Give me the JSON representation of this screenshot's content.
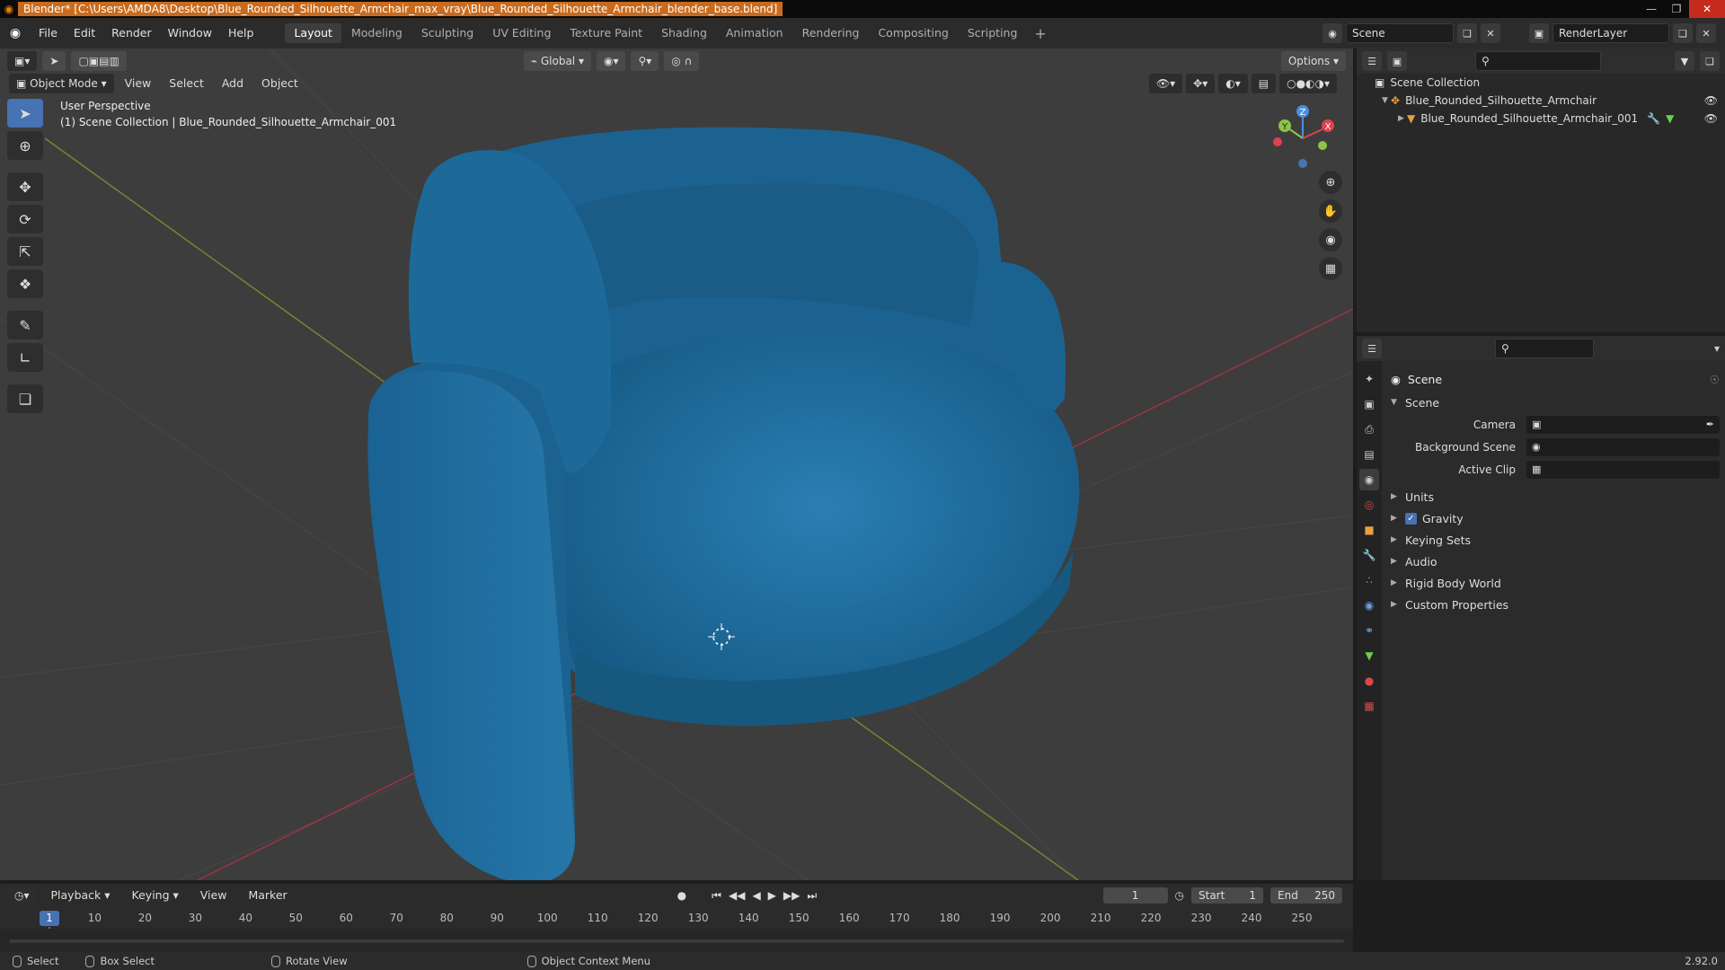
{
  "window": {
    "title": "Blender* [C:\\Users\\AMDA8\\Desktop\\Blue_Rounded_Silhouette_Armchair_max_vray\\Blue_Rounded_Silhouette_Armchair_blender_base.blend]"
  },
  "menu": [
    "File",
    "Edit",
    "Render",
    "Window",
    "Help"
  ],
  "workspaces": [
    "Layout",
    "Modeling",
    "Sculpting",
    "UV Editing",
    "Texture Paint",
    "Shading",
    "Animation",
    "Rendering",
    "Compositing",
    "Scripting"
  ],
  "active_workspace": "Layout",
  "scene_name": "Scene",
  "view_layer": "RenderLayer",
  "viewport": {
    "transform_orientation": "Global",
    "options_label": "Options",
    "mode": "Object Mode",
    "menus": [
      "View",
      "Select",
      "Add",
      "Object"
    ],
    "perspective": "User Perspective",
    "context": "(1) Scene Collection | Blue_Rounded_Silhouette_Armchair_001",
    "gizmo_axes": [
      "Z",
      "Y",
      "X"
    ]
  },
  "outliner": {
    "root": "Scene Collection",
    "items": [
      "Blue_Rounded_Silhouette_Armchair",
      "Blue_Rounded_Silhouette_Armchair_001"
    ]
  },
  "properties": {
    "title": "Scene",
    "panel": "Scene",
    "fields": [
      {
        "label": "Camera"
      },
      {
        "label": "Background Scene"
      },
      {
        "label": "Active Clip"
      }
    ],
    "subpanels": [
      "Units",
      "Gravity",
      "Keying Sets",
      "Audio",
      "Rigid Body World",
      "Custom Properties"
    ],
    "gravity_enabled": true
  },
  "timeline": {
    "menus": [
      "Playback",
      "Keying",
      "View",
      "Marker"
    ],
    "current_frame": "1",
    "start_label": "Start",
    "start": "1",
    "end_label": "End",
    "end": "250",
    "ruler": [
      "10",
      "20",
      "30",
      "40",
      "50",
      "60",
      "70",
      "80",
      "90",
      "100",
      "110",
      "120",
      "130",
      "140",
      "150",
      "160",
      "170",
      "180",
      "190",
      "200",
      "210",
      "220",
      "230",
      "240",
      "250"
    ]
  },
  "statusbar": {
    "select": "Select",
    "box_select": "Box Select",
    "rotate_view": "Rotate View",
    "context_menu": "Object Context Menu",
    "version": "2.92.0"
  },
  "colors": {
    "accent": "#4772b3",
    "title_highlight": "#c86b1e",
    "chair_blue": "#1f6b9a",
    "x_axis": "#e04050",
    "y_axis": "#8cc34a",
    "z_axis": "#4a8fe0"
  }
}
